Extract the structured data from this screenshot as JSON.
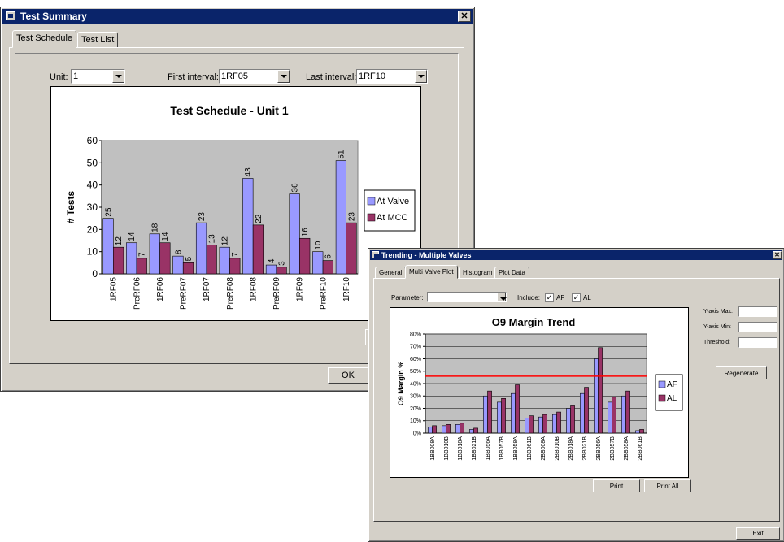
{
  "test_summary": {
    "title": "Test Summary",
    "close_glyph": "✕",
    "tabs": [
      "Test Schedule",
      "Test List"
    ],
    "unit_label": "Unit:",
    "unit_value": "1",
    "first_interval_label": "First interval:",
    "first_interval_value": "1RF05",
    "last_interval_label": "Last interval:",
    "last_interval_value": "1RF10",
    "ok_label": "OK"
  },
  "trending": {
    "title": "Trending - Multiple Valves",
    "tabs": [
      "General",
      "Multi Valve Plot",
      "Histogram",
      "Plot Data"
    ],
    "parameter_label": "Parameter:",
    "parameter_value": "",
    "include_label": "Include:",
    "include_af_label": "AF",
    "include_al_label": "AL",
    "check_glyph": "✓",
    "y_axis_max_label": "Y-axis Max:",
    "y_axis_min_label": "Y-axis Min:",
    "threshold_label": "Threshold:",
    "regenerate_label": "Regenerate",
    "print_label": "Print",
    "print_all_label": "Print All",
    "exit_label": "Exit"
  },
  "colors": {
    "series_a": "#9999ff",
    "series_b": "#993366",
    "plot_bg": "#c0c0c0",
    "threshold_line": "#ff0000",
    "titlebar": "#0a246a"
  },
  "chart_data": [
    {
      "type": "bar",
      "title": "Test Schedule - Unit 1",
      "ylabel": "# Tests",
      "xlabel": "",
      "ylim": [
        0,
        60
      ],
      "yticks": [
        "0",
        "10",
        "20",
        "30",
        "40",
        "50",
        "60"
      ],
      "categories": [
        "1RF05",
        "PreRF06",
        "1RF06",
        "PreRF07",
        "1RF07",
        "PreRF08",
        "1RF08",
        "PreRF09",
        "1RF09",
        "PreRF10",
        "1RF10"
      ],
      "series": [
        {
          "name": "At Valve",
          "values": [
            25,
            14,
            18,
            8,
            23,
            12,
            43,
            4,
            36,
            10,
            51
          ]
        },
        {
          "name": "At MCC",
          "values": [
            12,
            7,
            14,
            5,
            13,
            7,
            22,
            3,
            16,
            6,
            23
          ]
        }
      ],
      "data_labels": true,
      "legend": "right",
      "grid": false
    },
    {
      "type": "bar",
      "title": "O9 Margin Trend",
      "ylabel": "O9 Margin %",
      "xlabel": "",
      "ylim": [
        0,
        80
      ],
      "yticks": [
        "0%",
        "10%",
        "20%",
        "30%",
        "40%",
        "50%",
        "60%",
        "70%",
        "80%"
      ],
      "categories": [
        "1BB008A",
        "1BB010B",
        "1BB018A",
        "1BB021B",
        "1BB056A",
        "1BB057B",
        "1BB058A",
        "1BB061B",
        "2BB008A",
        "2BB010B",
        "2BB018A",
        "2BB021B",
        "2BB056A",
        "2BB057B",
        "2BB058A",
        "2BB061B"
      ],
      "series": [
        {
          "name": "AF",
          "values": [
            5,
            6,
            7,
            3,
            30,
            25,
            32,
            12,
            13,
            15,
            20,
            32,
            60,
            25,
            30,
            2
          ]
        },
        {
          "name": "AL",
          "values": [
            6,
            7,
            8,
            4,
            34,
            28,
            39,
            14,
            15,
            17,
            22,
            37,
            69,
            29,
            34,
            3
          ]
        }
      ],
      "threshold": 46,
      "legend": "right",
      "grid": true
    }
  ]
}
